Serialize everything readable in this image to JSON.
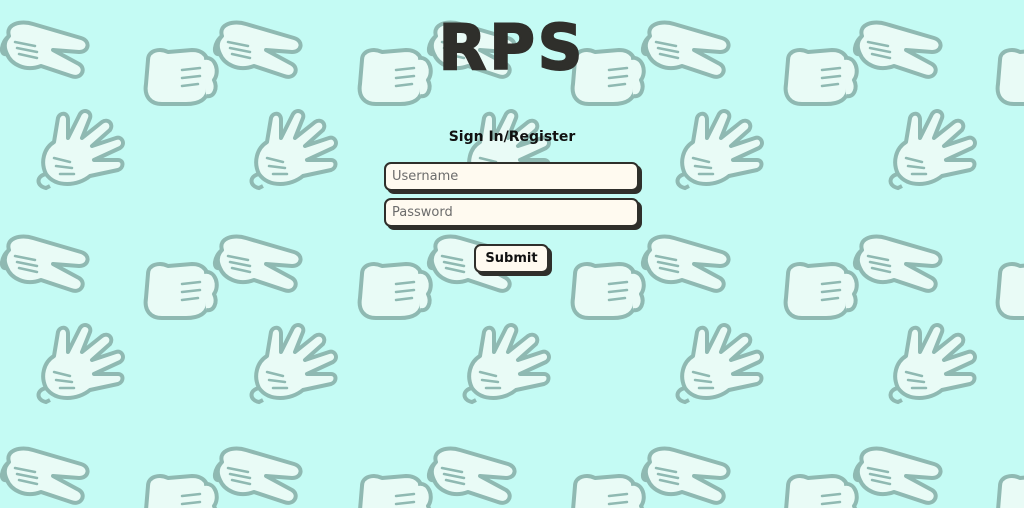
{
  "app": {
    "logo_text": "RPS"
  },
  "form": {
    "title": "Sign In/Register",
    "username_placeholder": "Username",
    "password_placeholder": "Password",
    "submit_label": "Submit"
  },
  "background": {
    "color": "#c4fbf4",
    "hand_fill": "#e9fbf6",
    "hand_stroke": "#8fb9b2",
    "pattern_icons": [
      "scissors-hand-icon",
      "rock-fist-icon",
      "paper-hand-icon"
    ]
  },
  "colors": {
    "text_dark": "#2f2f2b",
    "field_bg": "#fffaf0"
  }
}
